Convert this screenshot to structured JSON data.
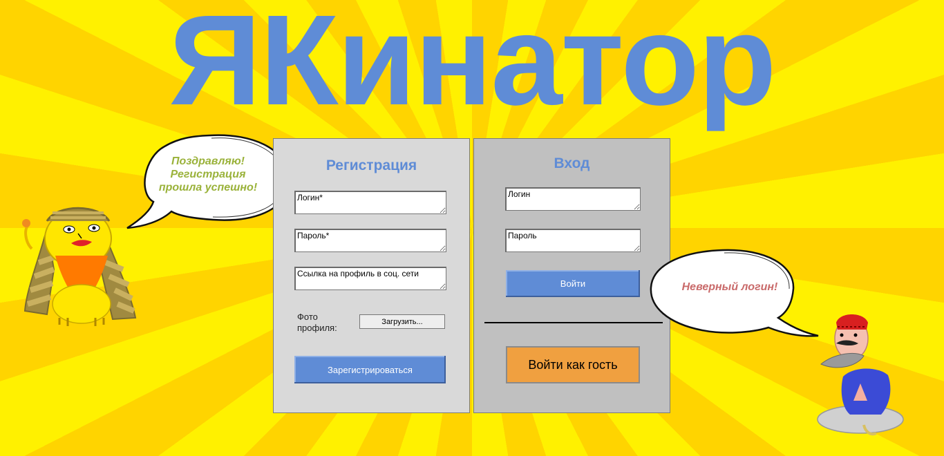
{
  "app": {
    "title": "ЯКинатор"
  },
  "registration": {
    "title": "Регистрация",
    "login_placeholder": "Логин*",
    "password_placeholder": "Пароль*",
    "social_placeholder": "Ссылка на профиль в соц. сети",
    "photo_label": "Фото профиля:",
    "upload_label": "Загрузить...",
    "submit_label": "Зарегистрироваться"
  },
  "login": {
    "title": "Вход",
    "login_placeholder": "Логин",
    "password_placeholder": "Пароль",
    "submit_label": "Войти",
    "guest_label": "Войти как гость"
  },
  "bubbles": {
    "success": "Поздравляю! Регистрация прошла успешно!",
    "error": "Неверный логин!"
  },
  "colors": {
    "accent": "#5f8cd6",
    "guest_button": "#f0a040",
    "success_text": "#9ab23a",
    "error_text": "#c96a6a",
    "background_light": "#fff100",
    "background_dark": "#ffd400"
  },
  "icons": {
    "left_character": "sphinx-character-icon",
    "right_character": "genie-character-icon"
  }
}
